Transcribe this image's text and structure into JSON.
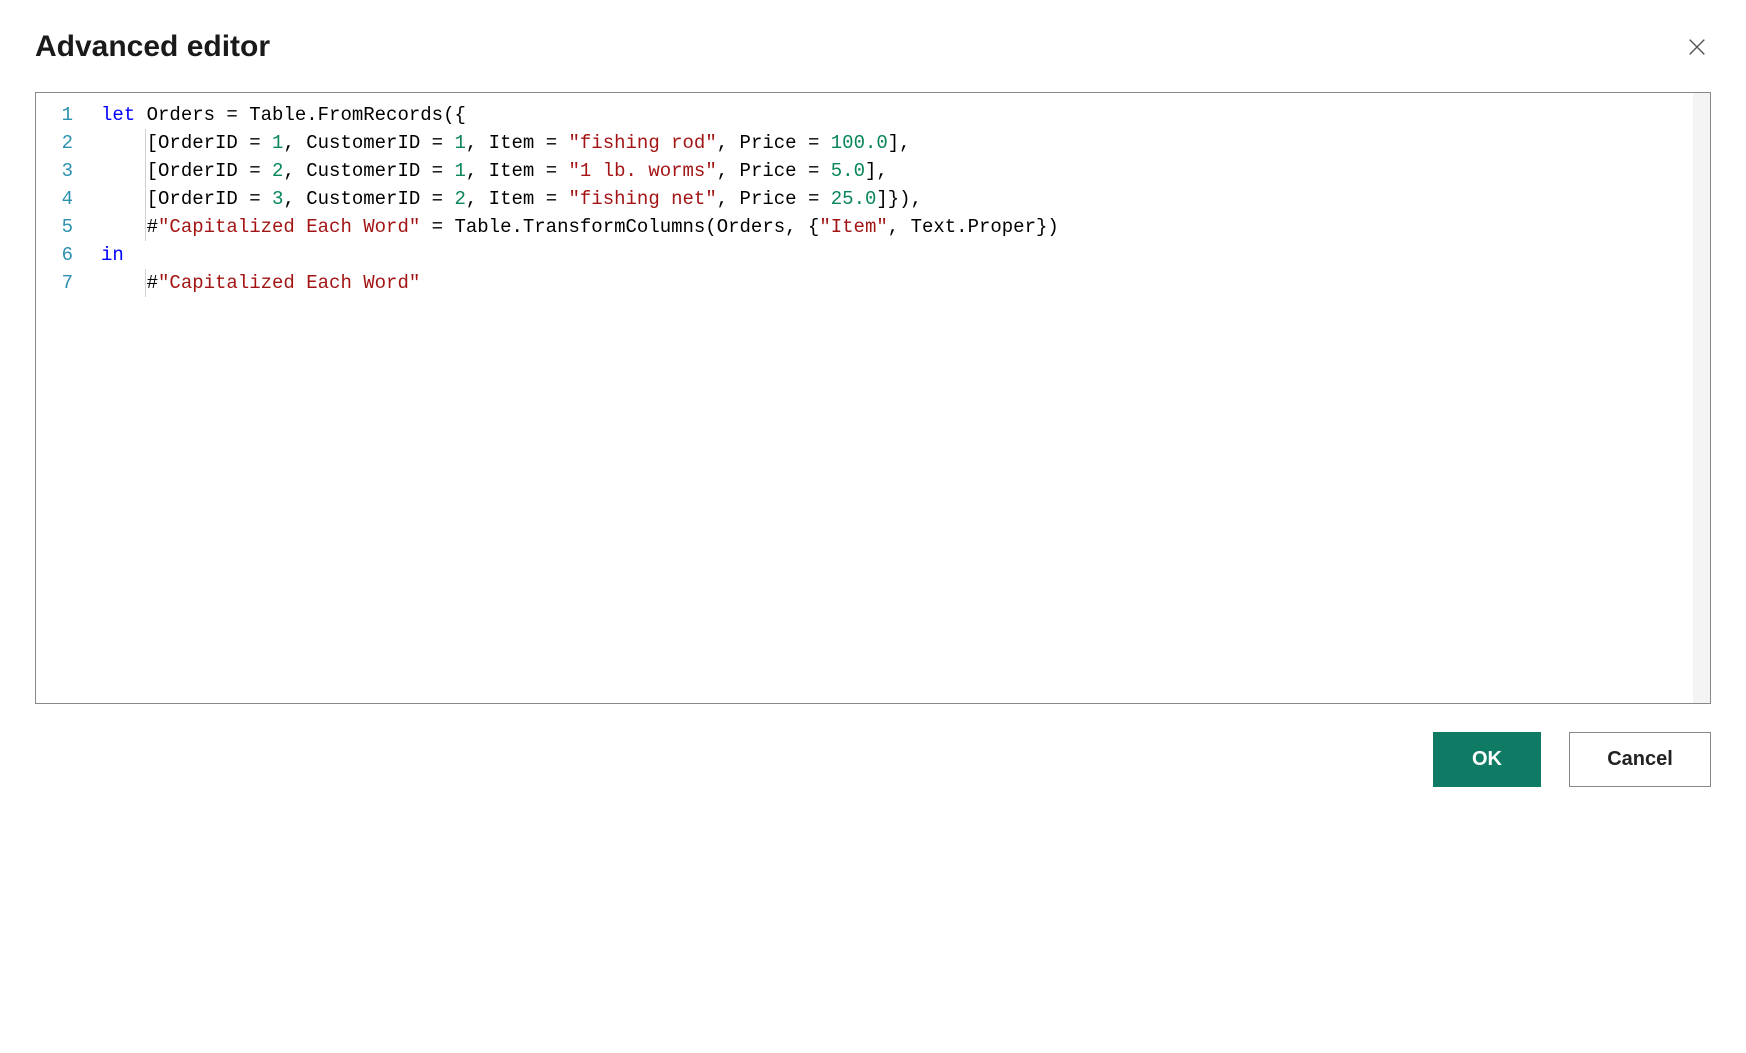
{
  "header": {
    "title": "Advanced editor"
  },
  "footer": {
    "ok_label": "OK",
    "cancel_label": "Cancel"
  },
  "editor": {
    "line_numbers": [
      "1",
      "2",
      "3",
      "4",
      "5",
      "6",
      "7"
    ],
    "lines": [
      {
        "indent": 0,
        "tokens": [
          {
            "t": "keyword",
            "v": "let"
          },
          {
            "t": "text",
            "v": " Orders = Table.FromRecords({"
          }
        ]
      },
      {
        "indent": 1,
        "tokens": [
          {
            "t": "text",
            "v": "    [OrderID = "
          },
          {
            "t": "number",
            "v": "1"
          },
          {
            "t": "text",
            "v": ", CustomerID = "
          },
          {
            "t": "number",
            "v": "1"
          },
          {
            "t": "text",
            "v": ", Item = "
          },
          {
            "t": "string",
            "v": "\"fishing rod\""
          },
          {
            "t": "text",
            "v": ", Price = "
          },
          {
            "t": "number",
            "v": "100.0"
          },
          {
            "t": "text",
            "v": "],"
          }
        ]
      },
      {
        "indent": 1,
        "tokens": [
          {
            "t": "text",
            "v": "    [OrderID = "
          },
          {
            "t": "number",
            "v": "2"
          },
          {
            "t": "text",
            "v": ", CustomerID = "
          },
          {
            "t": "number",
            "v": "1"
          },
          {
            "t": "text",
            "v": ", Item = "
          },
          {
            "t": "string",
            "v": "\"1 lb. worms\""
          },
          {
            "t": "text",
            "v": ", Price = "
          },
          {
            "t": "number",
            "v": "5.0"
          },
          {
            "t": "text",
            "v": "],"
          }
        ]
      },
      {
        "indent": 1,
        "tokens": [
          {
            "t": "text",
            "v": "    [OrderID = "
          },
          {
            "t": "number",
            "v": "3"
          },
          {
            "t": "text",
            "v": ", CustomerID = "
          },
          {
            "t": "number",
            "v": "2"
          },
          {
            "t": "text",
            "v": ", Item = "
          },
          {
            "t": "string",
            "v": "\"fishing net\""
          },
          {
            "t": "text",
            "v": ", Price = "
          },
          {
            "t": "number",
            "v": "25.0"
          },
          {
            "t": "text",
            "v": "]}),"
          }
        ]
      },
      {
        "indent": 1,
        "tokens": [
          {
            "t": "text",
            "v": "    #"
          },
          {
            "t": "string",
            "v": "\"Capitalized Each Word\""
          },
          {
            "t": "text",
            "v": " = Table.TransformColumns(Orders, {"
          },
          {
            "t": "string",
            "v": "\"Item\""
          },
          {
            "t": "text",
            "v": ", Text.Proper})"
          }
        ]
      },
      {
        "indent": 0,
        "tokens": [
          {
            "t": "keyword",
            "v": "in"
          }
        ]
      },
      {
        "indent": 1,
        "tokens": [
          {
            "t": "text",
            "v": "    #"
          },
          {
            "t": "string",
            "v": "\"Capitalized Each Word\""
          }
        ]
      }
    ]
  }
}
